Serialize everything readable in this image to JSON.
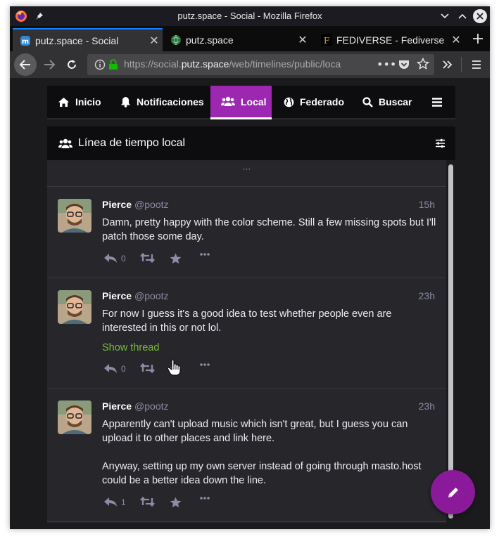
{
  "window": {
    "title": "putz.space - Social - Mozilla Firefox"
  },
  "tabs": [
    {
      "label": "putz.space - Social",
      "favicon": "mastodon-icon",
      "active": true
    },
    {
      "label": "putz.space",
      "favicon": "globe-icon",
      "active": false
    },
    {
      "label": "FEDIVERSE - Fediverse",
      "favicon": "fediverse-icon",
      "active": false
    }
  ],
  "urlbar": {
    "prefix": "https://social.",
    "domain": "putz.space",
    "path": "/web/timelines/public/loca"
  },
  "nav": {
    "items": [
      {
        "label": "Inicio",
        "icon": "home-icon"
      },
      {
        "label": "Notificaciones",
        "icon": "bell-icon"
      },
      {
        "label": "Local",
        "icon": "users-icon",
        "active": true
      },
      {
        "label": "Federado",
        "icon": "globe-icon"
      },
      {
        "label": "Buscar",
        "icon": "search-icon"
      }
    ],
    "menu_icon": "hamburger-icon"
  },
  "column": {
    "title": "Línea de tiempo local",
    "load_more": "···"
  },
  "statuses": [
    {
      "display_name": "Pierce",
      "acct": "@pootz",
      "time": "15h",
      "text": "Damn, pretty happy with the color scheme. Still a few missing spots but I'll patch those some day.",
      "replies": "0",
      "show_thread": ""
    },
    {
      "display_name": "Pierce",
      "acct": "@pootz",
      "time": "23h",
      "text": "For now I guess it's a good idea to test whether people even are interested in this or not lol.",
      "replies": "0",
      "show_thread": "Show thread"
    },
    {
      "display_name": "Pierce",
      "acct": "@pootz",
      "time": "23h",
      "text_p1": "Apparently can't upload music which isn't great, but I guess you can upload it to other places and link here.",
      "text_p2": "Anyway, setting up my own server instead of going through masto.host could be a better idea down the line.",
      "replies": "1",
      "show_thread": ""
    }
  ],
  "colors": {
    "accent": "#9c27b0",
    "fab": "#8b1a9a",
    "link_green": "#79bd3a",
    "muted": "#8c8da5"
  }
}
